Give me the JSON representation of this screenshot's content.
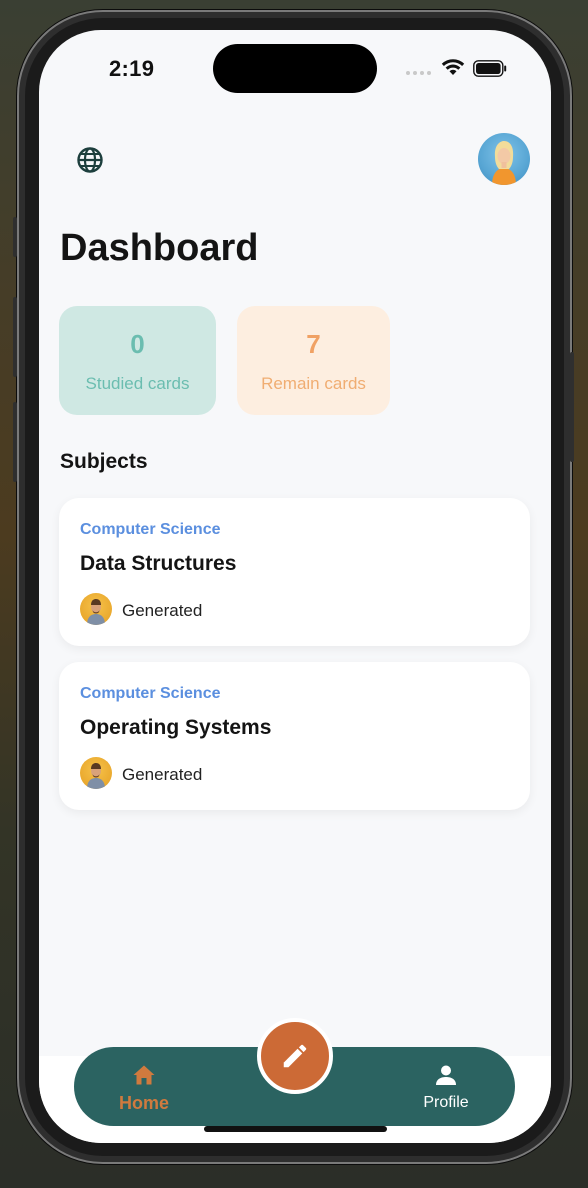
{
  "status_bar": {
    "time": "2:19"
  },
  "header": {
    "globe_icon": "globe-icon",
    "avatar": "user-avatar"
  },
  "page_title": "Dashboard",
  "stats": [
    {
      "value": "0",
      "label": "Studied cards",
      "color": "#6bbdb0",
      "background": "#cfe8e3"
    },
    {
      "value": "7",
      "label": "Remain cards",
      "color": "#f0a164",
      "background": "#fdeee0"
    }
  ],
  "subjects_title": "Subjects",
  "subjects": [
    {
      "category": "Computer Science",
      "name": "Data Structures",
      "author_label": "Generated"
    },
    {
      "category": "Computer Science",
      "name": "Operating Systems",
      "author_label": "Generated"
    }
  ],
  "tab_bar": {
    "home_label": "Home",
    "profile_label": "Profile",
    "fab_icon": "pencil-icon",
    "background": "#2b6361",
    "accent": "#cc6a36"
  }
}
